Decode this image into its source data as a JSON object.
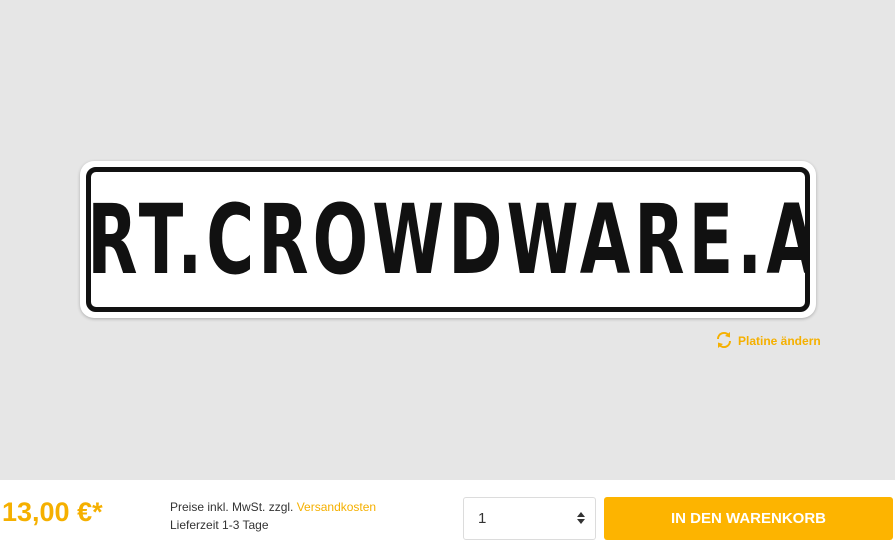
{
  "product": {
    "plate_text": "ART.CROWDWARE.AT",
    "change_plate_label": "Platine ändern"
  },
  "purchase": {
    "price": "13,00 €*",
    "tax_note": "Preise inkl. MwSt. zzgl.",
    "shipping_link": "Versandkosten",
    "delivery_time": "Lieferzeit 1-3 Tage",
    "quantity": "1",
    "add_to_cart_label": "IN DEN WARENKORB"
  },
  "colors": {
    "accent": "#fdb400",
    "preview_background": "#e6e6e6",
    "plate_ink": "#111111"
  },
  "icons": {
    "change_plate": "refresh-icon",
    "quantity": "stepper-arrows-icon"
  }
}
